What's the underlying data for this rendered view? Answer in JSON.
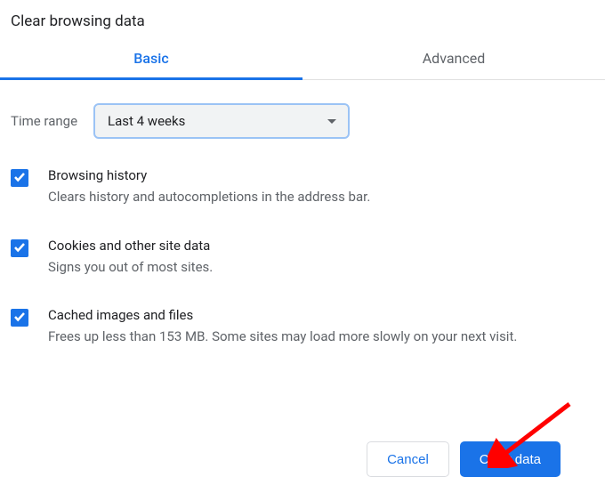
{
  "title": "Clear browsing data",
  "tabs": {
    "basic": "Basic",
    "advanced": "Advanced"
  },
  "time": {
    "label": "Time range",
    "value": "Last 4 weeks"
  },
  "options": [
    {
      "title": "Browsing history",
      "desc": "Clears history and autocompletions in the address bar."
    },
    {
      "title": "Cookies and other site data",
      "desc": "Signs you out of most sites."
    },
    {
      "title": "Cached images and files",
      "desc": "Frees up less than 153 MB. Some sites may load more slowly on your next visit."
    }
  ],
  "buttons": {
    "cancel": "Cancel",
    "clear": "Clear data"
  }
}
